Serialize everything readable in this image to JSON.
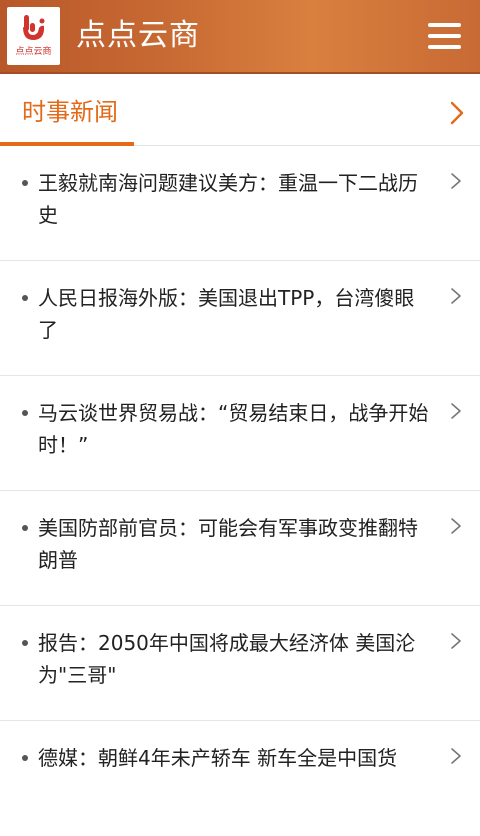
{
  "app": {
    "title": "点点云商",
    "logo_text": "点点云商"
  },
  "section": {
    "title": "时事新闻"
  },
  "news": [
    {
      "title": "王毅就南海问题建议美方：重温一下二战历史"
    },
    {
      "title": "人民日报海外版：美国退出TPP，台湾傻眼了"
    },
    {
      "title": "马云谈世界贸易战：“贸易结束日，战争开始时！”"
    },
    {
      "title": "美国防部前官员：可能会有军事政变推翻特朗普"
    },
    {
      "title": "报告：2050年中国将成最大经济体 美国沦为\"三哥\""
    },
    {
      "title": "德媒：朝鲜4年未产轿车 新车全是中国货"
    }
  ],
  "icons": {
    "logo": "hand-logo-icon",
    "menu": "hamburger-menu-icon",
    "more": "chevron-right-icon"
  },
  "colors": {
    "header": "#c86a33",
    "accent": "#e26a18",
    "logo_red": "#d2332e"
  }
}
